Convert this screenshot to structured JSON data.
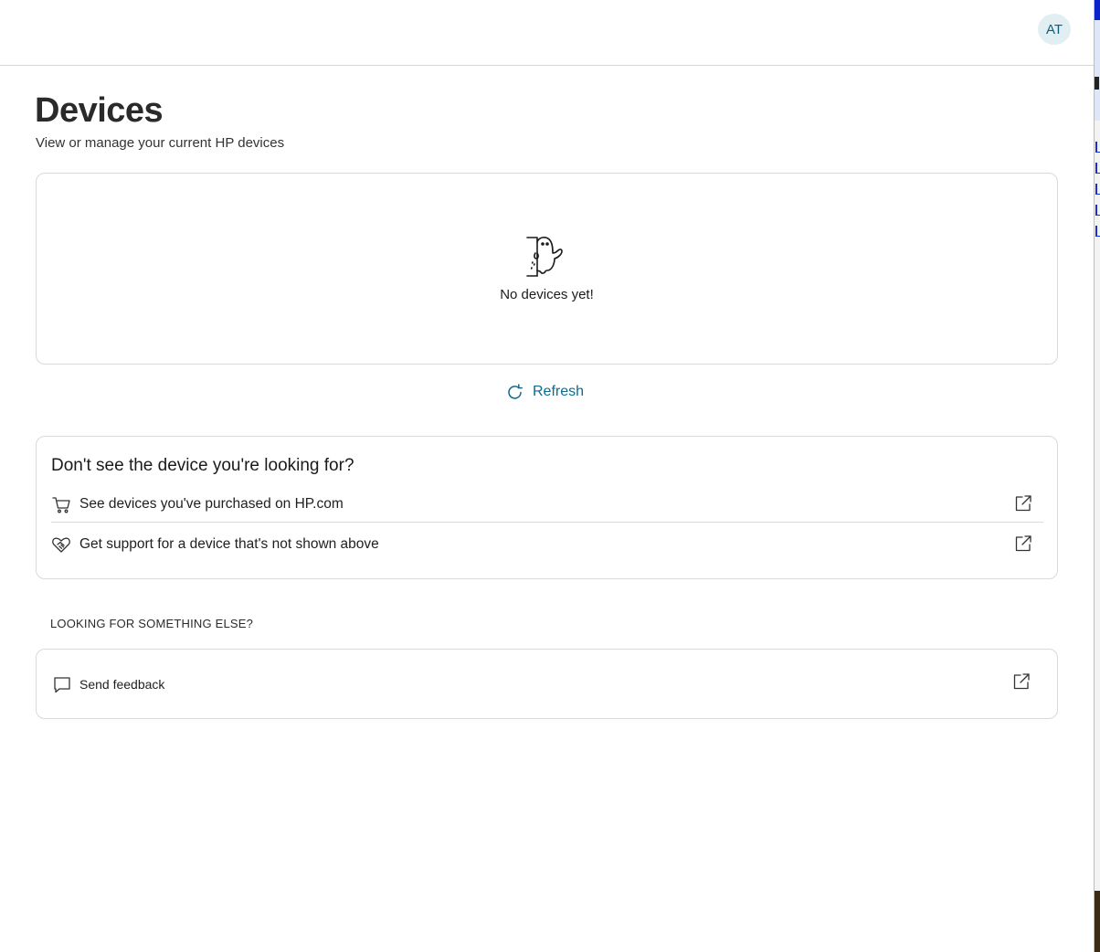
{
  "header": {
    "avatar_initials": "AT"
  },
  "page": {
    "title": "Devices",
    "subtitle": "View or manage your current HP devices"
  },
  "devices": {
    "empty_message": "No devices yet!",
    "illustration": "ghost-peeking-icon"
  },
  "refresh": {
    "label": "Refresh",
    "icon": "refresh-icon"
  },
  "help": {
    "title": "Don't see the device you're looking for?",
    "items": [
      {
        "label": "See devices you've purchased on HP.com",
        "icon": "cart-icon",
        "trailing_icon": "external-link-icon"
      },
      {
        "label": "Get support for a device that's not shown above",
        "icon": "heart-handshake-icon",
        "trailing_icon": "external-link-icon"
      }
    ]
  },
  "other": {
    "section_label": "LOOKING FOR SOMETHING ELSE?",
    "feedback_label": "Send feedback",
    "feedback_icon": "chat-bubble-icon",
    "trailing_icon": "external-link-icon"
  },
  "colors": {
    "accent": "#0b6b92",
    "avatar_bg": "#e1eef2",
    "border": "#d9d9d9"
  }
}
